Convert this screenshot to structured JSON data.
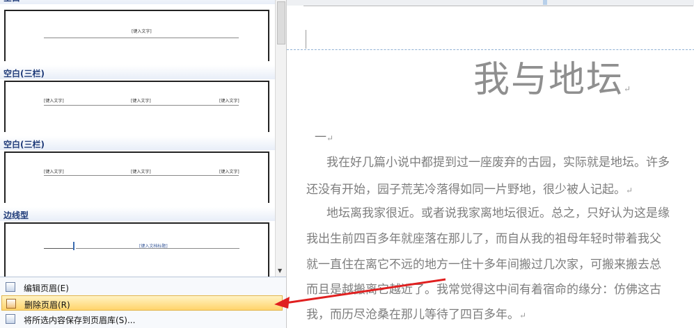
{
  "gallery": {
    "sections": [
      {
        "heading": "空白",
        "placeholders": [
          "[键入文字]"
        ]
      },
      {
        "heading": "空白(三栏)",
        "placeholders": [
          "[键入文字]",
          "[键入文字]",
          "[键入文字]"
        ]
      },
      {
        "heading": "空白(三栏)",
        "placeholders": [
          "[键入文字]",
          "[键入文字]",
          "[键入文字]"
        ]
      },
      {
        "heading": "边线型",
        "placeholders": [
          "[键入文档标题]"
        ]
      }
    ]
  },
  "menu": {
    "items": [
      {
        "label": "编辑页眉(E)",
        "icon": "edit-header-icon",
        "highlighted": false
      },
      {
        "label": "删除页眉(R)",
        "icon": "delete-header-icon",
        "highlighted": true
      },
      {
        "label": "将所选内容保存到页眉库(S)...",
        "icon": "save-to-gallery-icon",
        "highlighted": false
      }
    ]
  },
  "document": {
    "title": "我与地坛",
    "lines": [
      "一",
      "我在好几篇小说中都提到过一座废弃的古园，实际就是地坛。许多",
      "还没有开始，园子荒芜冷落得如同一片野地，很少被人记起。",
      "地坛离我家很近。或者说我家离地坛很近。总之，只好认为这是缘",
      "我出生前四百多年就座落在那儿了，而自从我的祖母年轻时带着我父",
      "就一直住在离它不远的地方一住十多年间搬过几次家，可搬来搬去总",
      "而且是越搬离它越近了。我常觉得这中间有着宿命的缘分：仿佛这古",
      "我，而历尽沧桑在那儿等待了四百多年。"
    ],
    "paragraph_mark": "↵"
  },
  "colors": {
    "accent": "#1e3a78",
    "highlight": "#ffd46b",
    "arrow": "#e02020",
    "body_text": "#7d7d7d"
  }
}
